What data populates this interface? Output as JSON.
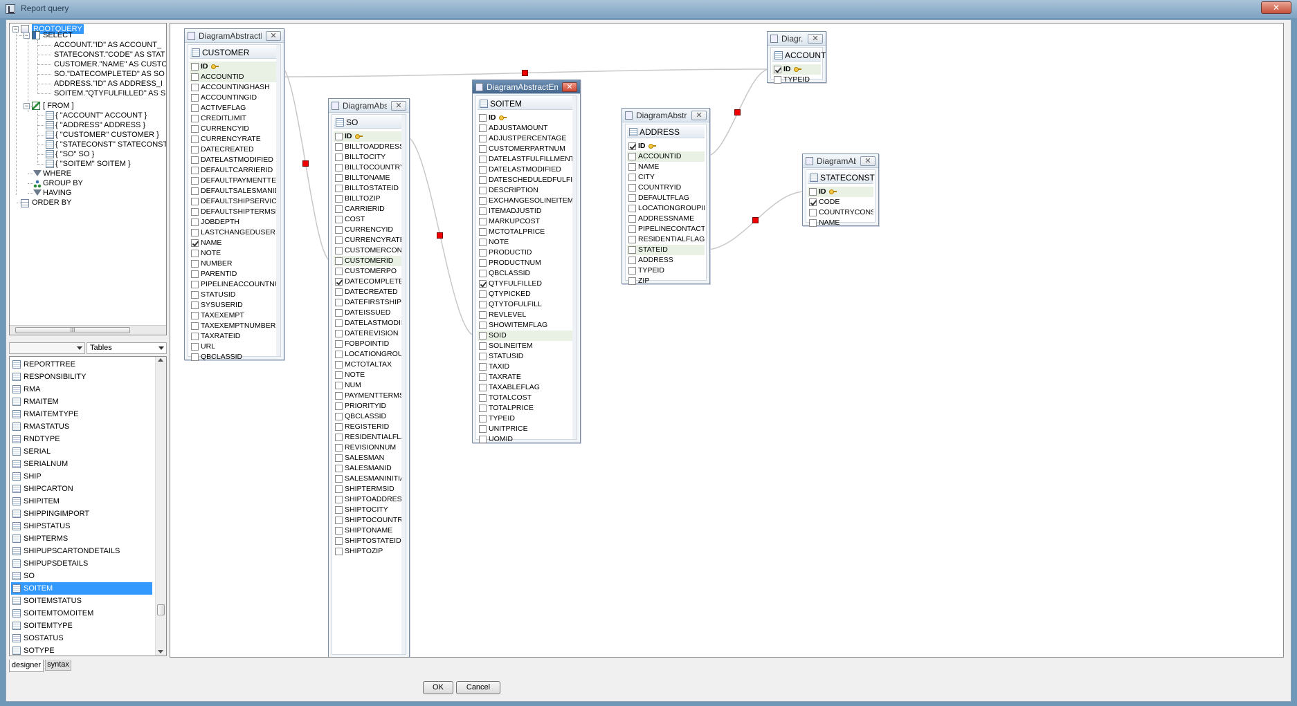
{
  "window": {
    "title": "Report query",
    "close_label": "✕"
  },
  "tree": {
    "root": "ROOTQUERY",
    "select": "SELECT",
    "select_items": [
      "ACCOUNT.\"ID\" AS ACCOUNT_",
      "STATECONST.\"CODE\" AS STAT",
      "CUSTOMER.\"NAME\" AS CUSTO",
      "SO.\"DATECOMPLETED\" AS SO",
      "ADDRESS.\"ID\" AS ADDRESS_I",
      "SOITEM.\"QTYFULFILLED\" AS S"
    ],
    "from": "[ FROM ]",
    "from_items": [
      "{ \"ACCOUNT\" ACCOUNT }",
      "{ \"ADDRESS\" ADDRESS }",
      "{ \"CUSTOMER\" CUSTOMER }",
      "{ \"STATECONST\" STATECONST",
      "{ \"SO\" SO }",
      "{ \"SOITEM\" SOITEM }"
    ],
    "where": "WHERE",
    "group_by": "GROUP BY",
    "having": "HAVING",
    "order_by": "ORDER BY",
    "scroll_grip": "III"
  },
  "tables_panel": {
    "combo_value": "Tables",
    "items": [
      "REPORTTREE",
      "RESPONSIBILITY",
      "RMA",
      "RMAITEM",
      "RMAITEMTYPE",
      "RMASTATUS",
      "RNDTYPE",
      "SERIAL",
      "SERIALNUM",
      "SHIP",
      "SHIPCARTON",
      "SHIPITEM",
      "SHIPPINGIMPORT",
      "SHIPSTATUS",
      "SHIPTERMS",
      "SHIPUPSCARTONDETAILS",
      "SHIPUPSDETAILS",
      "SO",
      "SOITEM",
      "SOITEMSTATUS",
      "SOITEMTOMOITEM",
      "SOITEMTYPE",
      "SOSTATUS",
      "SOTYPE"
    ],
    "selected": "SOITEM"
  },
  "tabs": {
    "designer": "designer",
    "syntax": "syntax"
  },
  "entities": {
    "customer": {
      "title": "DiagramAbstractEn...",
      "table": "CUSTOMER",
      "columns": [
        {
          "name": "ID",
          "checked": false,
          "pk": true,
          "hl": true
        },
        {
          "name": "ACCOUNTID",
          "checked": false,
          "hl": true
        },
        {
          "name": "ACCOUNTINGHASH",
          "checked": false
        },
        {
          "name": "ACCOUNTINGID",
          "checked": false
        },
        {
          "name": "ACTIVEFLAG",
          "checked": false
        },
        {
          "name": "CREDITLIMIT",
          "checked": false
        },
        {
          "name": "CURRENCYID",
          "checked": false
        },
        {
          "name": "CURRENCYRATE",
          "checked": false
        },
        {
          "name": "DATECREATED",
          "checked": false
        },
        {
          "name": "DATELASTMODIFIED",
          "checked": false
        },
        {
          "name": "DEFAULTCARRIERID",
          "checked": false
        },
        {
          "name": "DEFAULTPAYMENTTERMSID",
          "checked": false
        },
        {
          "name": "DEFAULTSALESMANID",
          "checked": false
        },
        {
          "name": "DEFAULTSHIPSERVICEID",
          "checked": false
        },
        {
          "name": "DEFAULTSHIPTERMSID",
          "checked": false
        },
        {
          "name": "JOBDEPTH",
          "checked": false
        },
        {
          "name": "LASTCHANGEDUSER",
          "checked": false
        },
        {
          "name": "NAME",
          "checked": true
        },
        {
          "name": "NOTE",
          "checked": false
        },
        {
          "name": "NUMBER",
          "checked": false
        },
        {
          "name": "PARENTID",
          "checked": false
        },
        {
          "name": "PIPELINEACCOUNTNUM",
          "checked": false
        },
        {
          "name": "STATUSID",
          "checked": false
        },
        {
          "name": "SYSUSERID",
          "checked": false
        },
        {
          "name": "TAXEXEMPT",
          "checked": false
        },
        {
          "name": "TAXEXEMPTNUMBER",
          "checked": false
        },
        {
          "name": "TAXRATEID",
          "checked": false
        },
        {
          "name": "URL",
          "checked": false
        },
        {
          "name": "QBCLASSID",
          "checked": false
        }
      ]
    },
    "so": {
      "title": "DiagramAbstr...",
      "table": "SO",
      "columns": [
        {
          "name": "ID",
          "checked": false,
          "pk": true,
          "hl": true
        },
        {
          "name": "BILLTOADDRESS",
          "checked": false
        },
        {
          "name": "BILLTOCITY",
          "checked": false
        },
        {
          "name": "BILLTOCOUNTRYID",
          "checked": false
        },
        {
          "name": "BILLTONAME",
          "checked": false
        },
        {
          "name": "BILLTOSTATEID",
          "checked": false
        },
        {
          "name": "BILLTOZIP",
          "checked": false
        },
        {
          "name": "CARRIERID",
          "checked": false
        },
        {
          "name": "COST",
          "checked": false
        },
        {
          "name": "CURRENCYID",
          "checked": false
        },
        {
          "name": "CURRENCYRATE",
          "checked": false
        },
        {
          "name": "CUSTOMERCONTACT",
          "checked": false
        },
        {
          "name": "CUSTOMERID",
          "checked": false,
          "hl": true
        },
        {
          "name": "CUSTOMERPO",
          "checked": false
        },
        {
          "name": "DATECOMPLETED",
          "checked": true
        },
        {
          "name": "DATECREATED",
          "checked": false
        },
        {
          "name": "DATEFIRSTSHIP",
          "checked": false
        },
        {
          "name": "DATEISSUED",
          "checked": false
        },
        {
          "name": "DATELASTMODIFIED",
          "checked": false
        },
        {
          "name": "DATEREVISION",
          "checked": false
        },
        {
          "name": "FOBPOINTID",
          "checked": false
        },
        {
          "name": "LOCATIONGROUPID",
          "checked": false
        },
        {
          "name": "MCTOTALTAX",
          "checked": false
        },
        {
          "name": "NOTE",
          "checked": false
        },
        {
          "name": "NUM",
          "checked": false
        },
        {
          "name": "PAYMENTTERMSID",
          "checked": false
        },
        {
          "name": "PRIORITYID",
          "checked": false
        },
        {
          "name": "QBCLASSID",
          "checked": false
        },
        {
          "name": "REGISTERID",
          "checked": false
        },
        {
          "name": "RESIDENTIALFLAG",
          "checked": false
        },
        {
          "name": "REVISIONNUM",
          "checked": false
        },
        {
          "name": "SALESMAN",
          "checked": false
        },
        {
          "name": "SALESMANID",
          "checked": false
        },
        {
          "name": "SALESMANINITIALS",
          "checked": false
        },
        {
          "name": "SHIPTERMSID",
          "checked": false
        },
        {
          "name": "SHIPTOADDRESS",
          "checked": false
        },
        {
          "name": "SHIPTOCITY",
          "checked": false
        },
        {
          "name": "SHIPTOCOUNTRYID",
          "checked": false
        },
        {
          "name": "SHIPTONAME",
          "checked": false
        },
        {
          "name": "SHIPTOSTATEID",
          "checked": false
        },
        {
          "name": "SHIPTOZIP",
          "checked": false
        }
      ]
    },
    "soitem": {
      "title": "DiagramAbstractEntity",
      "table": "SOITEM",
      "columns": [
        {
          "name": "ID",
          "checked": false,
          "pk": true
        },
        {
          "name": "ADJUSTAMOUNT",
          "checked": false
        },
        {
          "name": "ADJUSTPERCENTAGE",
          "checked": false
        },
        {
          "name": "CUSTOMERPARTNUM",
          "checked": false
        },
        {
          "name": "DATELASTFULFILLMENT",
          "checked": false
        },
        {
          "name": "DATELASTMODIFIED",
          "checked": false
        },
        {
          "name": "DATESCHEDULEDFULFILLMENT",
          "checked": false
        },
        {
          "name": "DESCRIPTION",
          "checked": false
        },
        {
          "name": "EXCHANGESOLINEITEM",
          "checked": false
        },
        {
          "name": "ITEMADJUSTID",
          "checked": false
        },
        {
          "name": "MARKUPCOST",
          "checked": false
        },
        {
          "name": "MCTOTALPRICE",
          "checked": false
        },
        {
          "name": "NOTE",
          "checked": false
        },
        {
          "name": "PRODUCTID",
          "checked": false
        },
        {
          "name": "PRODUCTNUM",
          "checked": false
        },
        {
          "name": "QBCLASSID",
          "checked": false
        },
        {
          "name": "QTYFULFILLED",
          "checked": true
        },
        {
          "name": "QTYPICKED",
          "checked": false
        },
        {
          "name": "QTYTOFULFILL",
          "checked": false
        },
        {
          "name": "REVLEVEL",
          "checked": false
        },
        {
          "name": "SHOWITEMFLAG",
          "checked": false
        },
        {
          "name": "SOID",
          "checked": false,
          "hl": true
        },
        {
          "name": "SOLINEITEM",
          "checked": false
        },
        {
          "name": "STATUSID",
          "checked": false
        },
        {
          "name": "TAXID",
          "checked": false
        },
        {
          "name": "TAXRATE",
          "checked": false
        },
        {
          "name": "TAXABLEFLAG",
          "checked": false
        },
        {
          "name": "TOTALCOST",
          "checked": false
        },
        {
          "name": "TOTALPRICE",
          "checked": false
        },
        {
          "name": "TYPEID",
          "checked": false
        },
        {
          "name": "UNITPRICE",
          "checked": false
        },
        {
          "name": "UOMID",
          "checked": false
        }
      ]
    },
    "address": {
      "title": "DiagramAbstra...",
      "table": "ADDRESS",
      "columns": [
        {
          "name": "ID",
          "checked": true,
          "pk": true
        },
        {
          "name": "ACCOUNTID",
          "checked": false,
          "hl": true
        },
        {
          "name": "NAME",
          "checked": false
        },
        {
          "name": "CITY",
          "checked": false
        },
        {
          "name": "COUNTRYID",
          "checked": false
        },
        {
          "name": "DEFAULTFLAG",
          "checked": false
        },
        {
          "name": "LOCATIONGROUPID",
          "checked": false
        },
        {
          "name": "ADDRESSNAME",
          "checked": false
        },
        {
          "name": "PIPELINECONTACTNUM",
          "checked": false
        },
        {
          "name": "RESIDENTIALFLAG",
          "checked": false
        },
        {
          "name": "STATEID",
          "checked": false,
          "hl": true
        },
        {
          "name": "ADDRESS",
          "checked": false
        },
        {
          "name": "TYPEID",
          "checked": false
        },
        {
          "name": "ZIP",
          "checked": false
        }
      ]
    },
    "account": {
      "title": "Diagr...",
      "table": "ACCOUNT",
      "columns": [
        {
          "name": "ID",
          "checked": true,
          "pk": true,
          "hl": true
        },
        {
          "name": "TYPEID",
          "checked": false
        }
      ]
    },
    "stateconst": {
      "title": "DiagramAb...",
      "table": "STATECONST",
      "columns": [
        {
          "name": "ID",
          "checked": false,
          "pk": true,
          "hl": true
        },
        {
          "name": "CODE",
          "checked": true
        },
        {
          "name": "COUNTRYCONSTID",
          "checked": false
        },
        {
          "name": "NAME",
          "checked": false
        }
      ]
    }
  },
  "buttons": {
    "ok": "OK",
    "cancel": "Cancel"
  },
  "colors": {
    "link": "#c8c8c8",
    "handle": "#e00000",
    "selection": "#3399ff",
    "highlight": "#e8f1e3"
  }
}
